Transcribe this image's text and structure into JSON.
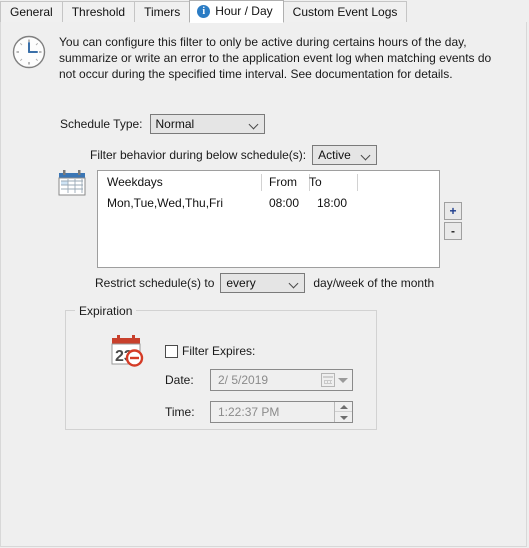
{
  "tabs": [
    {
      "label": "General",
      "active": false,
      "icon": null
    },
    {
      "label": "Threshold",
      "active": false,
      "icon": null
    },
    {
      "label": "Timers",
      "active": false,
      "icon": null
    },
    {
      "label": "Hour / Day",
      "active": true,
      "icon": "info-icon"
    },
    {
      "label": "Custom Event Logs",
      "active": false,
      "icon": null
    }
  ],
  "header": {
    "icon": "clock-icon",
    "description": "You can configure this filter to only be active during certains hours of the day, summarize or write an error to the application event log when matching events do not occur during the specified time interval. See documentation for details."
  },
  "schedule": {
    "type_label": "Schedule Type:",
    "type_value": "Normal",
    "behavior_label": "Filter behavior during below schedule(s):",
    "behavior_value": "Active",
    "calendar_icon": "calendar-icon",
    "columns": [
      "Weekdays",
      "From",
      "To"
    ],
    "rows": [
      {
        "weekdays": "Mon,Tue,Wed,Thu,Fri",
        "from": "08:00",
        "to": "18:00"
      }
    ],
    "add_button": "+",
    "remove_button": "-",
    "restrict_prefix": "Restrict schedule(s) to",
    "restrict_value": "every",
    "restrict_suffix": "day/week of the month"
  },
  "expiration": {
    "title": "Expiration",
    "icon": "calendar-expire-icon",
    "checkbox_label": "Filter Expires:",
    "checkbox_checked": false,
    "date_label": "Date:",
    "date_value": "2/  5/2019",
    "time_label": "Time:",
    "time_value": "1:22:37 PM"
  },
  "colors": {
    "accent_blue": "#2b7cc4",
    "calendar_blue": "#3b76b5",
    "expire_red": "#c8402c",
    "plus_blue": "#1b3a8c",
    "background": "#efefef",
    "field_bg": "#e5e5e5"
  }
}
